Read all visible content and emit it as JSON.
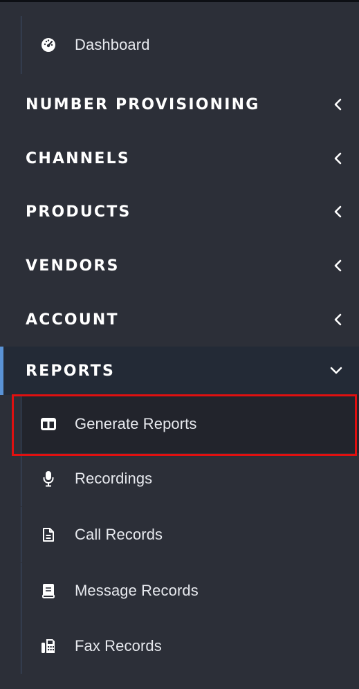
{
  "nav": {
    "dashboard": {
      "label": "Dashboard",
      "icon": "tachometer-icon"
    },
    "sections": [
      {
        "label": "NUMBER PROVISIONING",
        "state": "collapsed"
      },
      {
        "label": "CHANNELS",
        "state": "collapsed"
      },
      {
        "label": "PRODUCTS",
        "state": "collapsed"
      },
      {
        "label": "VENDORS",
        "state": "collapsed"
      },
      {
        "label": "ACCOUNT",
        "state": "collapsed"
      },
      {
        "label": "REPORTS",
        "state": "expanded"
      }
    ],
    "reports_items": [
      {
        "label": "Generate Reports",
        "icon": "columns-icon",
        "selected": true
      },
      {
        "label": "Recordings",
        "icon": "microphone-icon"
      },
      {
        "label": "Call Records",
        "icon": "file-text-icon"
      },
      {
        "label": "Message Records",
        "icon": "book-icon"
      },
      {
        "label": "Fax Records",
        "icon": "fax-icon"
      }
    ]
  },
  "colors": {
    "background": "#2c2f38",
    "active_section_bg": "#232a36",
    "accent": "#5a93d6",
    "highlight": "#e01010"
  }
}
